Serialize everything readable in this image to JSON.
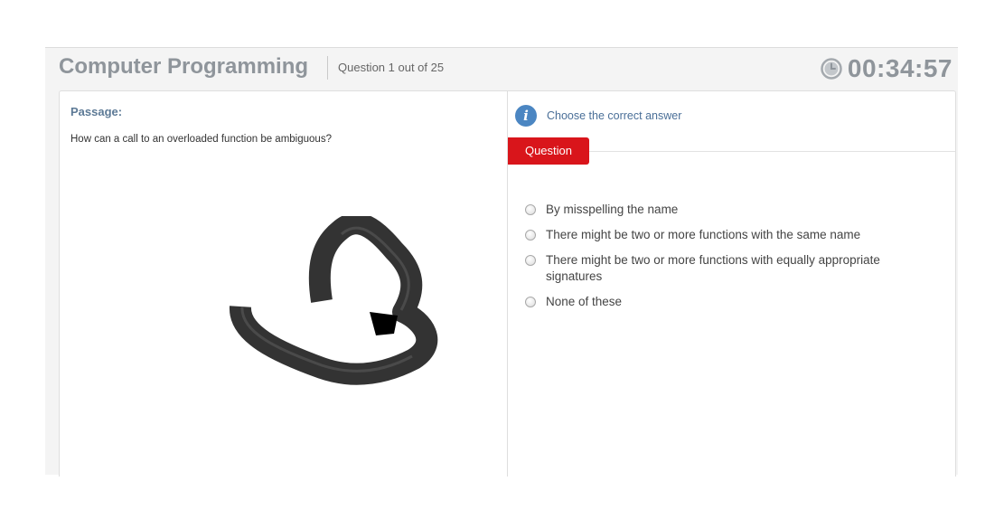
{
  "header": {
    "course_title": "Computer Programming",
    "question_counter": "Question 1 out of 25",
    "timer": "00:34:57",
    "timer_icon": "clock-icon"
  },
  "passage": {
    "label": "Passage:",
    "text": "How can a call to an overloaded function be ambiguous?"
  },
  "instruction": {
    "icon": "info-icon",
    "icon_glyph": "i",
    "text": "Choose the correct answer"
  },
  "question_tab": {
    "label": "Question"
  },
  "options": [
    {
      "label": "By misspelling the name",
      "selected": false
    },
    {
      "label": "There might be two or more functions with the same name",
      "selected": false
    },
    {
      "label": "There might be two or more functions with equally appropriate signatures",
      "selected": false
    },
    {
      "label": "None of these",
      "selected": false
    }
  ],
  "colors": {
    "accent_red": "#d9151b",
    "info_blue": "#4b86c2",
    "title_gray": "#8f959b",
    "label_blue": "#5d7a96"
  }
}
